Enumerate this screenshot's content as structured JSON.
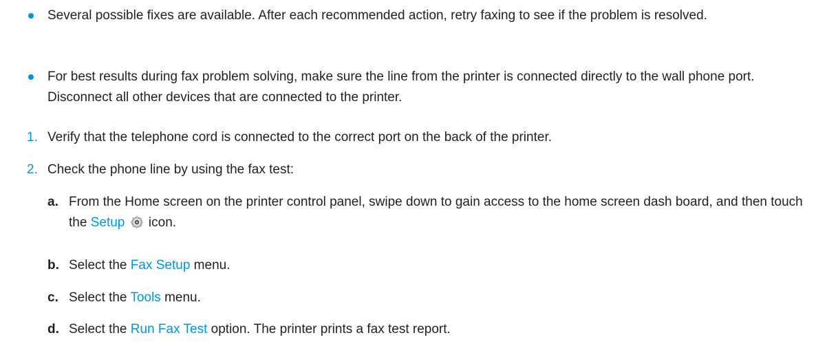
{
  "bullets": [
    {
      "text": "Several possible fixes are available. After each recommended action, retry faxing to see if the problem is resolved."
    },
    {
      "text": "For best results during fax problem solving, make sure the line from the printer is connected directly to the wall phone port. Disconnect all other devices that are connected to the printer."
    }
  ],
  "steps": [
    {
      "num": "1.",
      "text": "Verify that the telephone cord is connected to the correct port on the back of the printer."
    },
    {
      "num": "2.",
      "text": "Check the phone line by using the fax test:"
    }
  ],
  "substeps": [
    {
      "letter": "a.",
      "before": "From the Home screen on the printer control panel, swipe down to gain access to the home screen dash board, and then touch the ",
      "link": "Setup",
      "after": " icon.",
      "icon": "gear-icon"
    },
    {
      "letter": "b.",
      "before": "Select the ",
      "link": "Fax Setup",
      "after": " menu."
    },
    {
      "letter": "c.",
      "before": "Select the ",
      "link": "Tools",
      "after": " menu."
    },
    {
      "letter": "d.",
      "before": "Select the ",
      "link": "Run Fax Test",
      "after": " option. The printer prints a fax test report."
    }
  ],
  "colors": {
    "accent": "#0096d6",
    "text": "#231f20"
  }
}
